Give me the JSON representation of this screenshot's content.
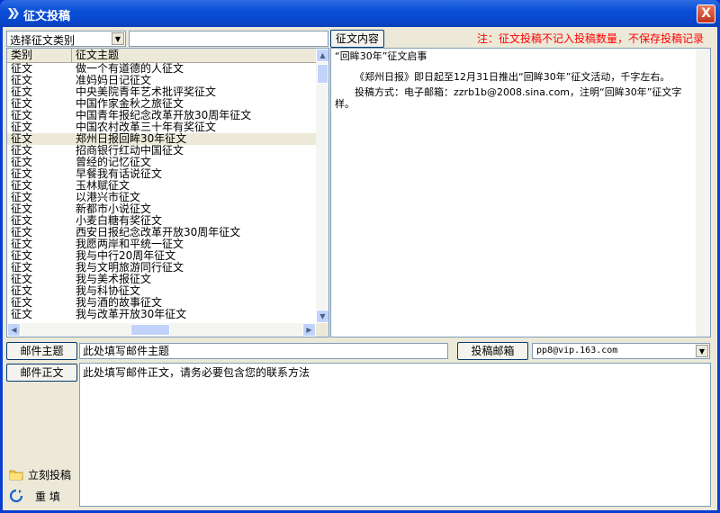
{
  "window": {
    "title": "征文投稿",
    "close_label": "X"
  },
  "filter": {
    "category_selected": "选择征文类别",
    "search_value": "",
    "content_button": "征文内容"
  },
  "notice": "注：征文投稿不记入投稿数量，不保存投稿记录",
  "list": {
    "headers": {
      "category": "类别",
      "topic": "征文主题"
    },
    "rows": [
      {
        "category": "征文",
        "topic": "做一个有道德的人征文"
      },
      {
        "category": "征文",
        "topic": "准妈妈日记征文"
      },
      {
        "category": "征文",
        "topic": "中央美院青年艺术批评奖征文"
      },
      {
        "category": "征文",
        "topic": "中国作家金秋之旅征文"
      },
      {
        "category": "征文",
        "topic": "中国青年报纪念改革开放30周年征文"
      },
      {
        "category": "征文",
        "topic": "中国农村改革三十年有奖征文"
      },
      {
        "category": "征文",
        "topic": "郑州日报回眸30年征文",
        "selected": true
      },
      {
        "category": "征文",
        "topic": "招商银行红动中国征文"
      },
      {
        "category": "征文",
        "topic": "曾经的记忆征文"
      },
      {
        "category": "征文",
        "topic": "早餐我有话说征文"
      },
      {
        "category": "征文",
        "topic": "玉林赋征文"
      },
      {
        "category": "征文",
        "topic": "以港兴市征文"
      },
      {
        "category": "征文",
        "topic": "新都市小说征文"
      },
      {
        "category": "征文",
        "topic": "小麦白糖有奖征文"
      },
      {
        "category": "征文",
        "topic": "西安日报纪念改革开放30周年征文"
      },
      {
        "category": "征文",
        "topic": "我愿两岸和平统一征文"
      },
      {
        "category": "征文",
        "topic": "我与中行20周年征文"
      },
      {
        "category": "征文",
        "topic": "我与文明旅游同行征文"
      },
      {
        "category": "征文",
        "topic": "我与美术报征文"
      },
      {
        "category": "征文",
        "topic": "我与科协征文"
      },
      {
        "category": "征文",
        "topic": "我与酒的故事征文"
      },
      {
        "category": "征文",
        "topic": "我与改革开放30年征文"
      }
    ]
  },
  "content": {
    "title": "“回眸30年”征文启事",
    "para1": "《郑州日报》即日起至12月31日推出“回眸30年”征文活动，千字左右。",
    "para2": "投稿方式：电子邮箱：zzrb1b@2008.sina.com，注明“回眸30年”征文字样。"
  },
  "mail": {
    "subject_button": "邮件主题",
    "subject_value": "此处填写邮件主题",
    "mailbox_button": "投稿邮箱",
    "mailbox_value": "pp8@vip.163.com",
    "body_button": "邮件正文",
    "body_value": "此处填写邮件正文，请务必要包含您的联系方法"
  },
  "actions": {
    "submit": "立刻投稿",
    "reset": "重  填"
  },
  "icons": {
    "title": "app-icon",
    "submit": "folder-icon",
    "reset": "refresh-icon"
  }
}
